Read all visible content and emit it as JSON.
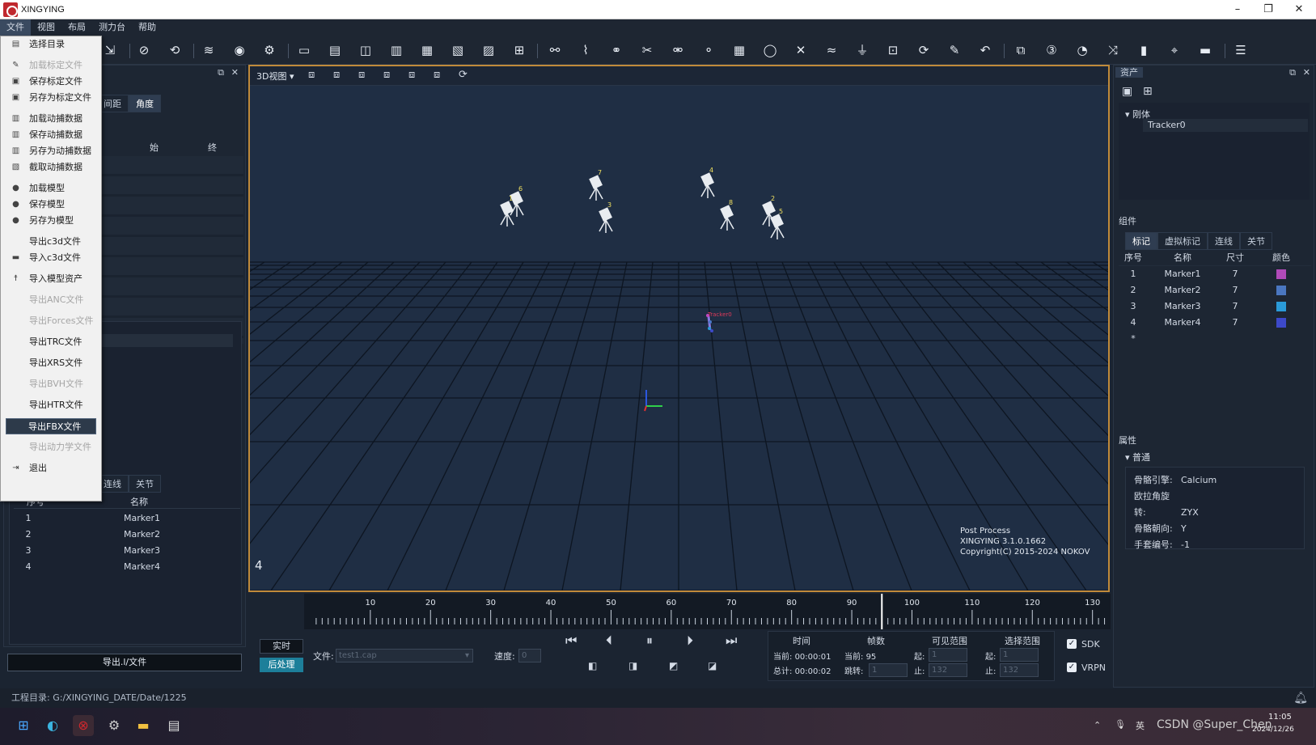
{
  "app": {
    "title": "XINGYING",
    "minimize": "–",
    "maximize": "❐",
    "close": "✕"
  },
  "menubar": [
    "文件",
    "视图",
    "布局",
    "测力台",
    "帮助"
  ],
  "file_menu": [
    {
      "label": "选择目录",
      "icon": "folder-icon",
      "disabled": false
    },
    {
      "sep": true
    },
    {
      "label": "加载标定文件",
      "icon": "wand-icon",
      "disabled": true
    },
    {
      "label": "保存标定文件",
      "icon": "save-icon",
      "disabled": false
    },
    {
      "label": "另存为标定文件",
      "icon": "save-as-icon",
      "disabled": false
    },
    {
      "sep": true
    },
    {
      "label": "加载动捕数据",
      "icon": "load-data-icon",
      "disabled": false
    },
    {
      "label": "保存动捕数据",
      "icon": "save-data-icon",
      "disabled": false
    },
    {
      "label": "另存为动捕数据",
      "icon": "save-as-data-icon",
      "disabled": false
    },
    {
      "label": "截取动捕数据",
      "icon": "crop-data-icon",
      "disabled": false
    },
    {
      "sep": true
    },
    {
      "label": "加载模型",
      "icon": "model-icon",
      "disabled": false
    },
    {
      "label": "保存模型",
      "icon": "model-save-icon",
      "disabled": false
    },
    {
      "label": "另存为模型",
      "icon": "model-save-as-icon",
      "disabled": false
    },
    {
      "sep": true
    },
    {
      "label": "导出c3d文件",
      "icon": "",
      "disabled": false
    },
    {
      "label": "导入c3d文件",
      "icon": "import-icon",
      "disabled": false
    },
    {
      "sep": true
    },
    {
      "label": "导入模型资产",
      "icon": "person-icon",
      "disabled": false
    },
    {
      "sep": true
    },
    {
      "label": "导出ANC文件",
      "icon": "",
      "disabled": true
    },
    {
      "sep": true
    },
    {
      "label": "导出Forces文件",
      "icon": "",
      "disabled": true
    },
    {
      "sep": true
    },
    {
      "label": "导出TRC文件",
      "icon": "",
      "disabled": false
    },
    {
      "sep": true
    },
    {
      "label": "导出XRS文件",
      "icon": "",
      "disabled": false
    },
    {
      "sep": true
    },
    {
      "label": "导出BVH文件",
      "icon": "",
      "disabled": true
    },
    {
      "sep": true
    },
    {
      "label": "导出HTR文件",
      "icon": "",
      "disabled": false
    },
    {
      "sep": true
    },
    {
      "label": "导出FBX文件",
      "icon": "",
      "disabled": false,
      "selected": true
    },
    {
      "sep": true
    },
    {
      "label": "导出动力学文件",
      "icon": "",
      "disabled": true
    },
    {
      "sep": true
    },
    {
      "label": "退出",
      "icon": "exit-icon",
      "disabled": false
    }
  ],
  "left_panel": {
    "tabs": [
      "间距",
      "角度"
    ],
    "header_start": "始",
    "header_end": "终",
    "bottom_tabs": [
      "连线",
      "关节"
    ],
    "col_index": "序号",
    "col_name": "名称",
    "markers": [
      {
        "index": "1",
        "name": "Marker1"
      },
      {
        "index": "2",
        "name": "Marker2"
      },
      {
        "index": "3",
        "name": "Marker3"
      },
      {
        "index": "4",
        "name": "Marker4"
      }
    ],
    "export_button": "导出.l/文件"
  },
  "viewport": {
    "view_mode": "3D视图",
    "tracker_label": "Tracker0",
    "corner_number": "4",
    "info": [
      "Post Process",
      "XINGYING 3.1.0.1662",
      "Copyright(C) 2015-2024 NOKOV"
    ],
    "cameras": [
      "6",
      "1",
      "7",
      "3",
      "4",
      "8",
      "2",
      "5"
    ]
  },
  "timeline": {
    "ticks": [
      "10",
      "20",
      "30",
      "40",
      "50",
      "60",
      "70",
      "80",
      "90",
      "100",
      "110",
      "120",
      "130"
    ],
    "current_frame": 95,
    "max_frame": 132
  },
  "controls": {
    "realtime": "实时",
    "postprocess": "后处理",
    "file_label": "文件:",
    "file_value": "test1.cap",
    "speed_label": "速度:",
    "speed_value": "0",
    "time_header": "时间",
    "frames_header": "帧数",
    "visible_header": "可见范围",
    "select_header": "选择范围",
    "current_time_label": "当前:",
    "current_time": "00:00:01",
    "total_time_label": "总计:",
    "total_time": "00:00:02",
    "current_frame_label": "当前:",
    "current_frame": "95",
    "jump_label": "跳转:",
    "jump_value": "1",
    "from_label": "起:",
    "to_label": "止:",
    "visible_from": "1",
    "visible_to": "132",
    "select_from": "1",
    "select_to": "132",
    "sdk": "SDK",
    "vrpn": "VRPN"
  },
  "assets": {
    "title": "资产",
    "group": "刚体",
    "items": [
      "Tracker0"
    ],
    "components_title": "组件",
    "tabs": [
      "标记",
      "虚拟标记",
      "连线",
      "关节"
    ],
    "columns": [
      "序号",
      "名称",
      "尺寸",
      "颜色"
    ],
    "rows": [
      {
        "index": "1",
        "name": "Marker1",
        "size": "7",
        "color": "#b04ab8"
      },
      {
        "index": "2",
        "name": "Marker2",
        "size": "7",
        "color": "#4a76c0"
      },
      {
        "index": "3",
        "name": "Marker3",
        "size": "7",
        "color": "#2a9ad8"
      },
      {
        "index": "4",
        "name": "Marker4",
        "size": "7",
        "color": "#3d49c9"
      }
    ],
    "new_row": "*"
  },
  "properties": {
    "title": "属性",
    "group": "普通",
    "items": [
      {
        "label": "骨骼引擎:",
        "value": "Calcium"
      },
      {
        "label": "欧拉角旋转:",
        "value": "ZYX"
      },
      {
        "label": "骨骼朝向:",
        "value": "Y"
      },
      {
        "label": "手套编号:",
        "value": "-1"
      }
    ]
  },
  "status": {
    "label": "工程目录:",
    "path": "G:/XINGYING_DATE/Date/1225"
  },
  "taskbar": {
    "lang": "英",
    "time": "11:05",
    "date": "2024/12/26",
    "watermark": "CSDN @Super_Chen"
  }
}
